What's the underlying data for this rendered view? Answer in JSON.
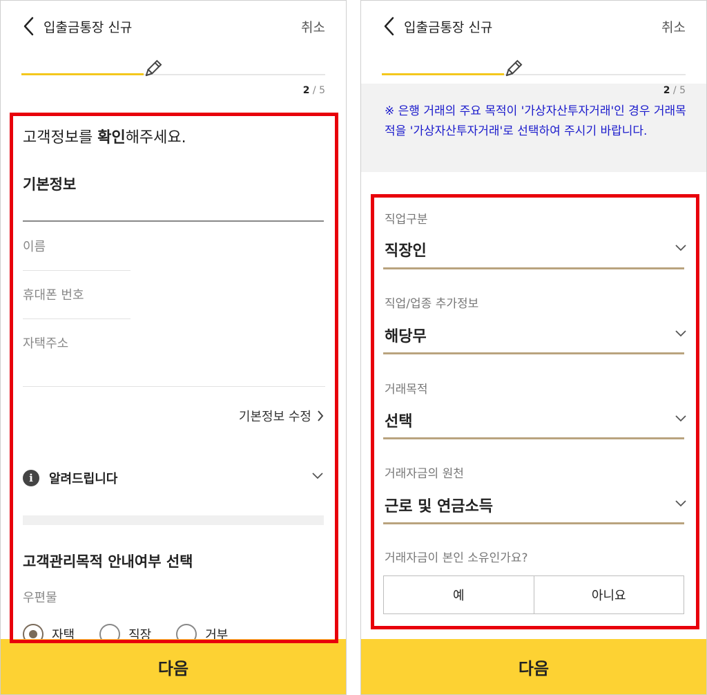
{
  "left": {
    "header": {
      "title": "입출금통장 신규",
      "cancel": "취소"
    },
    "step": {
      "current": "2",
      "total": "/ 5"
    },
    "progress_fraction": 0.4,
    "confirm": {
      "prefix": "고객정보를 ",
      "bold": "확인",
      "suffix": "해주세요."
    },
    "basic_title": "기본정보",
    "fields": {
      "name": "이름",
      "phone": "휴대폰 번호",
      "address": "자택주소"
    },
    "edit_link": "기본정보 수정",
    "notice": "알려드립니다",
    "purpose_title": "고객관리목적 안내여부 선택",
    "mail_label": "우편물",
    "radios": [
      {
        "label": "자택",
        "selected": true
      },
      {
        "label": "직장",
        "selected": false
      },
      {
        "label": "거부",
        "selected": false
      }
    ],
    "next": "다음"
  },
  "right": {
    "header": {
      "title": "입출금통장 신규",
      "cancel": "취소"
    },
    "step": {
      "current": "2",
      "total": "/ 5"
    },
    "progress_fraction": 0.4,
    "info": "※ 은행 거래의 주요 목적이 '가상자산투자거래'인 경우 거래목적을 '가상자산투자거래'로 선택하여 주시기 바랍니다.",
    "selects": [
      {
        "label": "직업구분",
        "value": "직장인"
      },
      {
        "label": "직업/업종 추가정보",
        "value": "해당무"
      },
      {
        "label": "거래목적",
        "value": "선택"
      },
      {
        "label": "거래자금의 원천",
        "value": "근로 및 연금소득"
      }
    ],
    "own_question": "거래자금이 본인 소유인가요?",
    "yes": "예",
    "no": "아니요",
    "next": "다음"
  },
  "colors": {
    "accent_yellow": "#fdd233",
    "progress": "#f4c71c",
    "highlight_red": "#e8000b",
    "underline_gold": "#b9a37e",
    "info_blue": "#1a1acc"
  }
}
